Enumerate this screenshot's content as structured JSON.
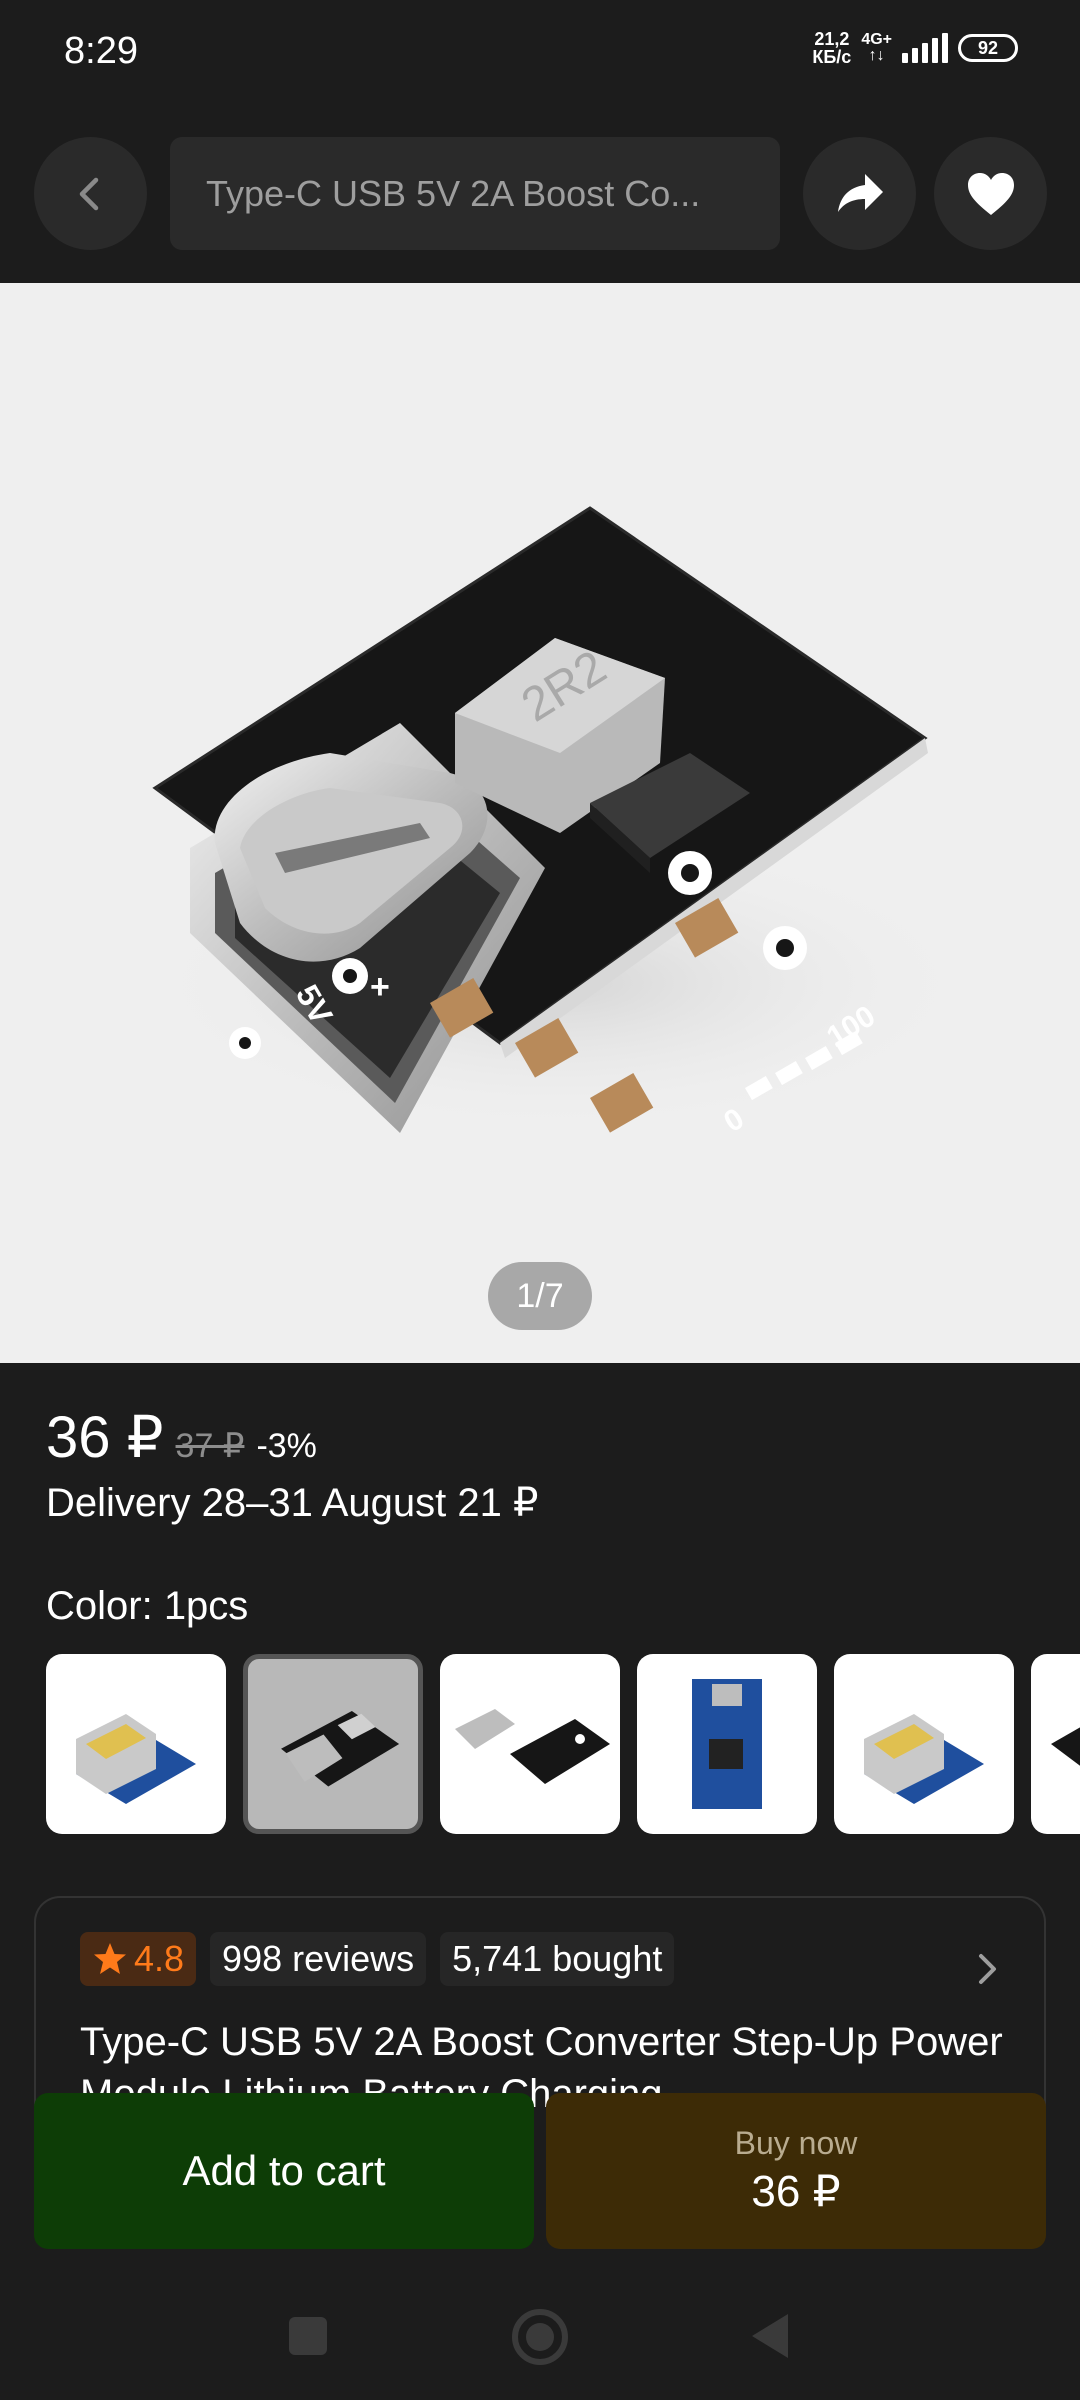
{
  "status_bar": {
    "time": "8:29",
    "speed_value": "21,2",
    "speed_unit": "КБ/с",
    "network_top": "4G+",
    "network_bottom": "↑↓",
    "battery": "92"
  },
  "header": {
    "search_text": "Type-C USB 5V 2A Boost Co...",
    "back_icon": "chevron-left-icon",
    "share_icon": "share-arrow-icon",
    "favorite_icon": "heart-icon"
  },
  "gallery": {
    "counter": "1/7",
    "board_label_5v": "5V",
    "board_label_plus": "+",
    "board_label_100": "100",
    "board_label_0": "0",
    "inductor_marking": "2R2",
    "colors": {
      "pcb": "#161616",
      "background": "#efefef"
    }
  },
  "price": {
    "current": "36 ₽",
    "old": "37 ₽",
    "discount": "-3%",
    "delivery": "Delivery 28–31 August 21 ₽"
  },
  "color": {
    "label": "Color: 1pcs",
    "variants": [
      {
        "board": "blue",
        "selected": false
      },
      {
        "board": "black",
        "selected": true
      },
      {
        "board": "black",
        "selected": false
      },
      {
        "board": "blue",
        "selected": false
      },
      {
        "board": "blue",
        "selected": false
      },
      {
        "board": "black",
        "selected": false
      }
    ]
  },
  "info_card": {
    "rating": "4.8",
    "reviews": "998 reviews",
    "bought": "5,741 bought",
    "title": "Type-C USB 5V 2A Boost Converter Step-Up Power Module Lithium Battery Charging"
  },
  "actions": {
    "add_to_cart": "Add to cart",
    "buy_now": "Buy now",
    "buy_price": "36 ₽"
  },
  "colors": {
    "cart_button": "#0d3d06",
    "buy_button": "#3d2b06",
    "rating_accent": "#ff7a1a"
  }
}
